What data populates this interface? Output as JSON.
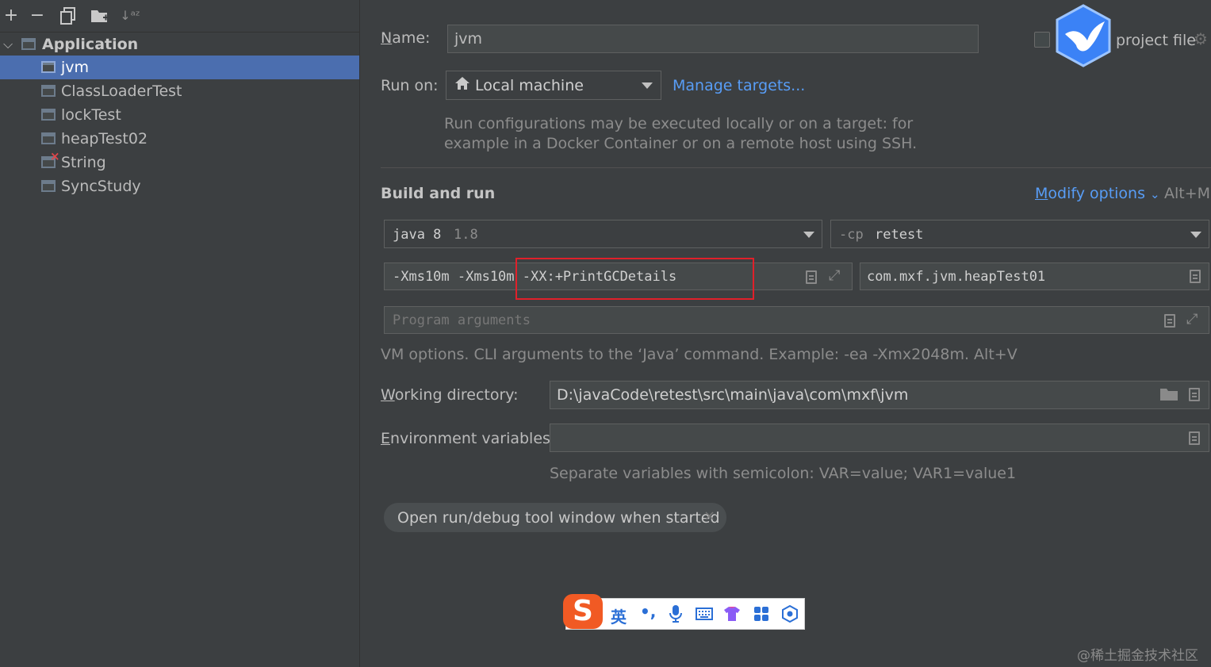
{
  "toolbar": {
    "add_icon": "plus-icon",
    "remove_icon": "minus-icon",
    "copy_icon": "copy-icon",
    "folder_icon": "new-folder-icon",
    "sort_icon": "sort-icon"
  },
  "tree": {
    "group": "Application",
    "items": [
      {
        "label": "jvm",
        "selected": true
      },
      {
        "label": "ClassLoaderTest",
        "selected": false
      },
      {
        "label": "lockTest",
        "selected": false
      },
      {
        "label": "heapTest02",
        "selected": false
      },
      {
        "label": "String",
        "selected": false,
        "error": true
      },
      {
        "label": "SyncStudy",
        "selected": false
      }
    ]
  },
  "form": {
    "name_label": "Name:",
    "name_mnemonic": "N",
    "name_rest": "ame:",
    "name_value": "jvm",
    "store_label": "project file",
    "run_on_label": "Run on:",
    "run_on_value": "Local machine",
    "manage_targets": "Manage targets...",
    "run_on_hint_1": "Run configurations may be executed locally or on a target: for",
    "run_on_hint_2": "example in a Docker Container or on a remote host using SSH.",
    "section_title": "Build and run",
    "modify_options": "Modify options",
    "modify_options_m": "M",
    "modify_options_rest": "odify options",
    "modify_shortcut": "Alt+M",
    "jdk_name": "java 8",
    "jdk_version": "1.8",
    "cp_flag": "-cp",
    "cp_value": "retest",
    "vm_options": "-Xms10m -Xms10m -XX:+PrintGCDetails",
    "main_class": "com.mxf.jvm.heapTest01",
    "program_args_placeholder": "Program arguments",
    "vm_hint": "VM options. CLI arguments to the ‘Java’ command. Example: -ea -Xmx2048m. Alt+V",
    "working_dir_label_w": "W",
    "working_dir_label_rest": "orking directory:",
    "working_dir_value": "D:\\javaCode\\retest\\src\\main\\java\\com\\mxf\\jvm",
    "env_label_e": "E",
    "env_label_rest": "nvironment variables:",
    "env_value": "",
    "env_hint": "Separate variables with semicolon: VAR=value; VAR1=value1",
    "chip_label": "Open run/debug tool window when started"
  },
  "ime": {
    "logo": "S",
    "lang": "英",
    "punct": "•,",
    "icons": [
      "microphone-icon",
      "keyboard-icon",
      "shirt-icon",
      "apps-icon",
      "settings-icon"
    ]
  },
  "watermark": "@稀土掘金技术社区",
  "colors": {
    "selection": "#4b6eaf",
    "link": "#589df6",
    "highlight_box": "#e0202a"
  }
}
